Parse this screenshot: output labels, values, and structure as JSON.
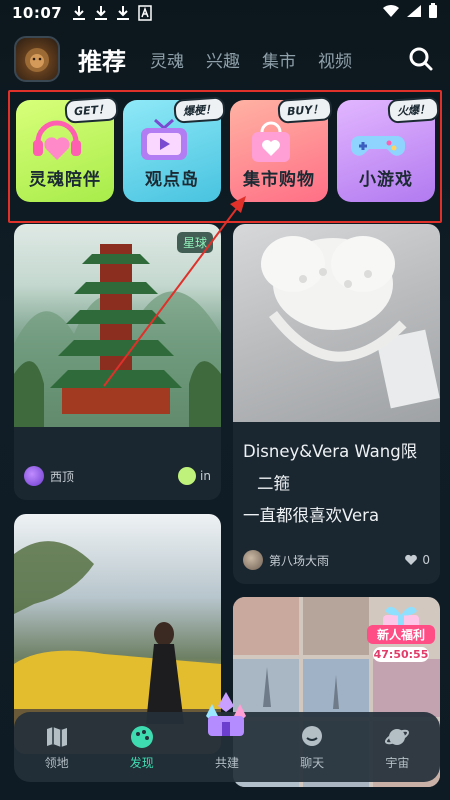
{
  "status_bar": {
    "time": "10:07"
  },
  "top_nav": {
    "tabs": [
      {
        "label": "推荐",
        "active": true
      },
      {
        "label": "灵魂",
        "active": false
      },
      {
        "label": "兴趣",
        "active": false
      },
      {
        "label": "集市",
        "active": false
      },
      {
        "label": "视频",
        "active": false
      }
    ],
    "search_icon": "search-icon"
  },
  "entries": [
    {
      "label": "灵魂陪伴",
      "tag": "GET！",
      "icon": "heart-headphones-icon",
      "color": "#b8f05a"
    },
    {
      "label": "观点岛",
      "tag": "爆梗！",
      "icon": "tv-icon",
      "color": "#5fd1e8"
    },
    {
      "label": "集市购物",
      "tag": "BUY！",
      "icon": "shopping-bag-icon",
      "color": "#ff7f8e"
    },
    {
      "label": "小游戏",
      "tag": "火爆！",
      "icon": "gamepad-icon",
      "color": "#c48cf5"
    }
  ],
  "feed": {
    "card1": {
      "badge": "星球",
      "author": "西顶",
      "like_text": "in"
    },
    "card2": {
      "title_line1": "Disney&Vera Wang限",
      "title_line2": "二箍",
      "title_line3": "一直都很喜欢Vera",
      "author": "第八场大雨",
      "likes": "0"
    },
    "card4": {
      "promo_title": "新人福利",
      "countdown": "47:50:55"
    }
  },
  "bottom_nav": [
    {
      "label": "领地",
      "icon": "map-icon",
      "active": false
    },
    {
      "label": "发现",
      "icon": "palette-icon",
      "active": true
    },
    {
      "label": "共建",
      "icon": "crystal-castle-icon",
      "active": false
    },
    {
      "label": "聊天",
      "icon": "chat-bubble-icon",
      "active": false
    },
    {
      "label": "宇宙",
      "icon": "planet-icon",
      "active": false
    }
  ],
  "colors": {
    "accent": "#3fdbb0",
    "highlight_box": "#e0302a",
    "background": "#0f1a22"
  }
}
